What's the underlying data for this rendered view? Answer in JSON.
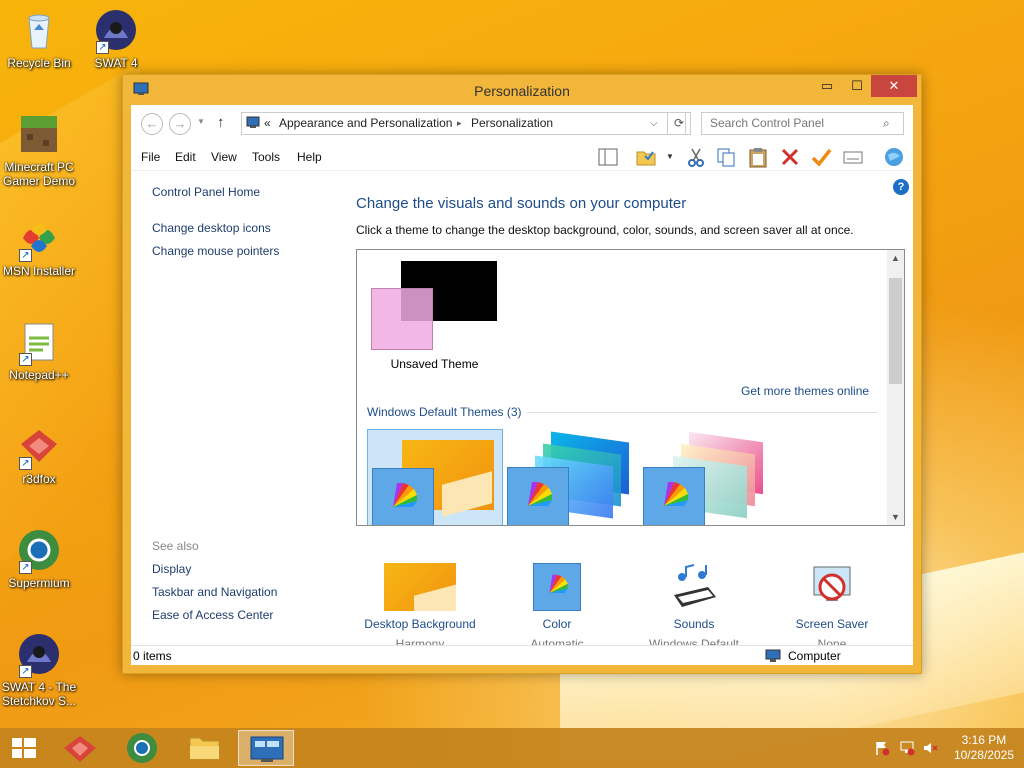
{
  "desktop": {
    "icons": [
      {
        "label": "Recycle Bin",
        "icon": "recycle-bin-icon"
      },
      {
        "label": "SWAT 4",
        "icon": "swat4-icon"
      },
      {
        "label": "Minecraft PC Gamer Demo",
        "icon": "minecraft-icon"
      },
      {
        "label": "MSN Installer",
        "icon": "msn-icon"
      },
      {
        "label": "Notepad++",
        "icon": "notepadpp-icon"
      },
      {
        "label": "r3dfox",
        "icon": "r3dfox-icon"
      },
      {
        "label": "Supermium",
        "icon": "supermium-icon"
      },
      {
        "label": "SWAT 4 - The Stetchkov S...",
        "icon": "swat4-icon"
      }
    ]
  },
  "window": {
    "title": "Personalization",
    "minimize": "▭",
    "maximize": "☐",
    "close": "✕",
    "back": "←",
    "forward": "→",
    "up": "↑",
    "breadcrumb": {
      "prefix": "«",
      "items": [
        "Appearance and Personalization",
        "Personalization"
      ],
      "separator": "▸"
    },
    "search_placeholder": "Search Control Panel",
    "menu": [
      "File",
      "Edit",
      "View",
      "Tools",
      "Help"
    ],
    "help": "?",
    "left_links": [
      "Control Panel Home",
      "Change desktop icons",
      "Change mouse pointers"
    ],
    "see_also_label": "See also",
    "see_also": [
      "Display",
      "Taskbar and Navigation",
      "Ease of Access Center"
    ],
    "heading": "Change the visuals and sounds on your computer",
    "subheading": "Click a theme to change the desktop background, color, sounds, and screen saver all at once.",
    "themes": {
      "unsaved_label": "Unsaved Theme",
      "get_more_link": "Get more themes online",
      "group_label": "Windows Default Themes (3)"
    },
    "bottom_options": [
      {
        "label": "Desktop Background",
        "value": "Harmony"
      },
      {
        "label": "Color",
        "value": "Automatic"
      },
      {
        "label": "Sounds",
        "value": "Windows Default"
      },
      {
        "label": "Screen Saver",
        "value": "None"
      }
    ],
    "status": {
      "items": "0 items",
      "location": "Computer"
    }
  },
  "taskbar": {
    "time": "3:16 PM",
    "date": "10/28/2025"
  },
  "colors": {
    "titlebar": "#f2b63a",
    "link": "#1e4d8a",
    "close": "#c8463d"
  }
}
